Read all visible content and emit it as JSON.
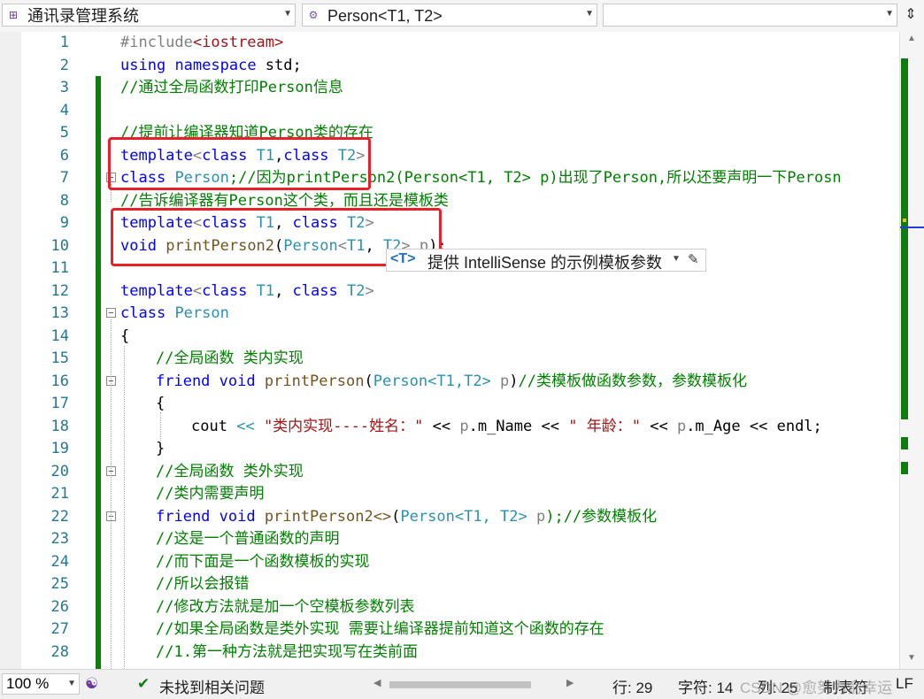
{
  "toolbar": {
    "project_dropdown": "通讯录管理系统",
    "scope_dropdown": "Person<T1, T2>",
    "member_dropdown": ""
  },
  "editor": {
    "lines": [
      {
        "n": "1"
      },
      {
        "n": "2"
      },
      {
        "n": "3"
      },
      {
        "n": "4"
      },
      {
        "n": "5"
      },
      {
        "n": "6"
      },
      {
        "n": "7"
      },
      {
        "n": "8"
      },
      {
        "n": "9"
      },
      {
        "n": "10"
      },
      {
        "n": "11"
      },
      {
        "n": "12"
      },
      {
        "n": "13"
      },
      {
        "n": "14"
      },
      {
        "n": "15"
      },
      {
        "n": "16"
      },
      {
        "n": "17"
      },
      {
        "n": "18"
      },
      {
        "n": "19"
      },
      {
        "n": "20"
      },
      {
        "n": "21"
      },
      {
        "n": "22"
      },
      {
        "n": "23"
      },
      {
        "n": "24"
      },
      {
        "n": "25"
      },
      {
        "n": "26"
      },
      {
        "n": "27"
      },
      {
        "n": "28"
      }
    ],
    "code": {
      "l1a": "#include",
      "l1b": "<iostream>",
      "l2a": "using",
      "l2b": "namespace",
      "l2c": " std;",
      "l3": "//通过全局函数打印Person信息",
      "l5": "//提前让编译器知道Person类的存在",
      "l6a": "template",
      "l6b": "<",
      "l6c": "class",
      "l6d": "T1",
      "l6e": ",",
      "l6f": "class",
      "l6g": "T2",
      "l6h": ">",
      "l7a": "class",
      "l7b": "Person",
      "l7c": ";//因为printPerson2(Person<T1, T2> p)出现了Person,所以还要声明一下Perosn",
      "l8": "//告诉编译器有Person这个类，而且还是模板类",
      "l9a": "template",
      "l9b": "<",
      "l9c": "class",
      "l9d": "T1",
      "l9e": ", ",
      "l9f": "class",
      "l9g": "T2",
      "l9h": ">",
      "l10a": "void",
      "l10b": "printPerson2",
      "l10c": "(",
      "l10d": "Person",
      "l10e": "<",
      "l10f": "T1",
      "l10g": ", ",
      "l10h": "T2",
      "l10i": ">",
      "l10j": "p",
      "l10k": ");",
      "l12a": "template",
      "l12b": "<",
      "l12c": "class",
      "l12d": "T1",
      "l12e": ", ",
      "l12f": "class",
      "l12g": "T2",
      "l12h": ">",
      "l13a": "class",
      "l13b": "Person",
      "l14": "{",
      "l15": "//全局函数 类内实现",
      "l16a": "friend",
      "l16b": "void",
      "l16c": "printPerson",
      "l16d": "(",
      "l16e": "Person",
      "l16f": "<T1,T2>",
      "l16g": "p",
      "l16h": ")",
      "l16i": "//类模板做函数参数，参数模板化",
      "l17": "{",
      "l18a": "cout",
      "l18b": "<<",
      "l18c": "\"类内实现----姓名：\"",
      "l18d": "<<",
      "l18e": "p",
      "l18f": ".m_Name",
      "l18g": "<<",
      "l18h": "\" 年龄：\"",
      "l18i": "<<",
      "l18j": "p",
      "l18k": ".m_Age",
      "l18l": "<<",
      "l18m": "endl;",
      "l19": "}",
      "l20": "//全局函数 类外实现",
      "l21": "//类内需要声明",
      "l22a": "friend",
      "l22b": "void",
      "l22c": "printPerson2<>",
      "l22d": "(",
      "l22e": "Person",
      "l22f": "<T1, T2>",
      "l22g": "p",
      "l22h": ");//参数模板化",
      "l23": "//这是一个普通函数的声明",
      "l24": "//而下面是一个函数模板的实现",
      "l25": "//所以会报错",
      "l26": "//修改方法就是加一个空模板参数列表",
      "l27": "//如果全局函数是类外实现 需要让编译器提前知道这个函数的存在",
      "l28": "//1.第一种方法就是把实现写在类前面"
    },
    "hint": {
      "tag": "<T>",
      "text": "提供 IntelliSense 的示例模板参数"
    }
  },
  "statusbar": {
    "zoom": "100 %",
    "issues": "未找到相关问题",
    "line": "行: 29",
    "char": "字符: 14",
    "col": "列: 25",
    "tab": "制表符",
    "eol": "LF",
    "watermark": "CSDN @愈努力俞幸运"
  },
  "colors": {
    "keyword": "#0000ff",
    "type": "#2b91af",
    "comment": "#008000",
    "string": "#a31515",
    "change_bar": "#107c10",
    "highlight_box": "#e8202a"
  }
}
